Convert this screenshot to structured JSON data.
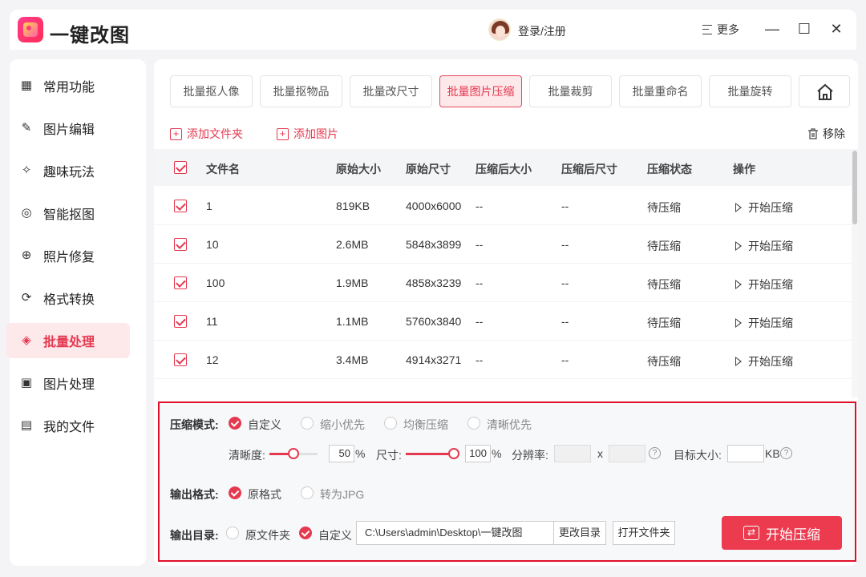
{
  "app": {
    "name": "一键改图",
    "login": "登录/注册",
    "more": "更多"
  },
  "sidebar": {
    "items": [
      {
        "label": "常用功能",
        "icon": "grid-icon"
      },
      {
        "label": "图片编辑",
        "icon": "edit-icon"
      },
      {
        "label": "趣味玩法",
        "icon": "magic-icon"
      },
      {
        "label": "智能抠图",
        "icon": "target-icon"
      },
      {
        "label": "照片修复",
        "icon": "repair-icon"
      },
      {
        "label": "格式转换",
        "icon": "convert-icon"
      },
      {
        "label": "批量处理",
        "icon": "layers-icon",
        "active": true
      },
      {
        "label": "图片处理",
        "icon": "image-icon"
      },
      {
        "label": "我的文件",
        "icon": "file-icon"
      }
    ]
  },
  "tabs": [
    "批量抠人像",
    "批量抠物品",
    "批量改尺寸",
    "批量图片压缩",
    "批量裁剪",
    "批量重命名",
    "批量旋转"
  ],
  "actions": {
    "add_folder": "添加文件夹",
    "add_image": "添加图片",
    "remove": "移除"
  },
  "table": {
    "headers": [
      "文件名",
      "原始大小",
      "原始尺寸",
      "压缩后大小",
      "压缩后尺寸",
      "压缩状态",
      "操作"
    ],
    "rows": [
      {
        "name": "1",
        "size": "819KB",
        "dim": "4000x6000",
        "csize": "--",
        "cdim": "--",
        "status": "待压缩",
        "op": "开始压缩"
      },
      {
        "name": "10",
        "size": "2.6MB",
        "dim": "5848x3899",
        "csize": "--",
        "cdim": "--",
        "status": "待压缩",
        "op": "开始压缩"
      },
      {
        "name": "100",
        "size": "1.9MB",
        "dim": "4858x3239",
        "csize": "--",
        "cdim": "--",
        "status": "待压缩",
        "op": "开始压缩"
      },
      {
        "name": "11",
        "size": "1.1MB",
        "dim": "5760x3840",
        "csize": "--",
        "cdim": "--",
        "status": "待压缩",
        "op": "开始压缩"
      },
      {
        "name": "12",
        "size": "3.4MB",
        "dim": "4914x3271",
        "csize": "--",
        "cdim": "--",
        "status": "待压缩",
        "op": "开始压缩"
      }
    ]
  },
  "settings": {
    "mode_label": "压缩模式:",
    "modes": [
      "自定义",
      "缩小优先",
      "均衡压缩",
      "清晰优先"
    ],
    "clarity_label": "清晰度:",
    "clarity_value": "50",
    "clarity_level": 0.5,
    "size_label": "尺寸:",
    "size_value": "100",
    "size_level": 1.0,
    "percent": "%",
    "resolution_label": "分辨率:",
    "x": "x",
    "target_label": "目标大小:",
    "kb": "KB",
    "format_label": "输出格式:",
    "formats": [
      "原格式",
      "转为JPG"
    ],
    "dir_label": "输出目录:",
    "dirs": [
      "原文件夹",
      "自定义"
    ],
    "path": "C:\\Users\\admin\\Desktop\\一键改图",
    "change_dir": "更改目录",
    "open_folder": "打开文件夹",
    "start": "开始压缩"
  },
  "colors": {
    "accent": "#e53950",
    "highlight_border": "#e0102a",
    "active_bg": "#fde8ea"
  }
}
